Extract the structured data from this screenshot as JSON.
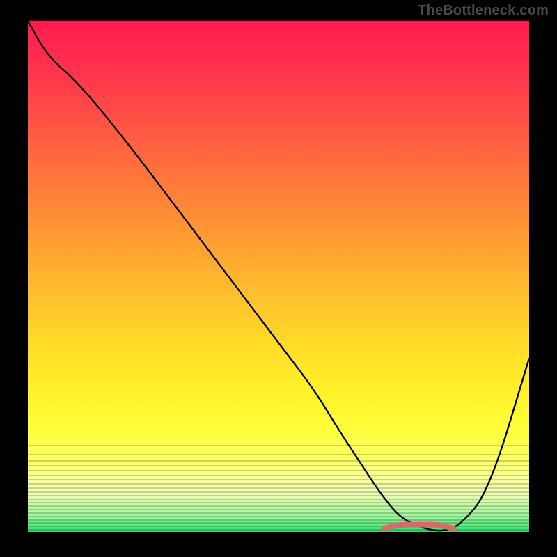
{
  "watermark": "TheBottleneck.com",
  "colors": {
    "frame": "#000000",
    "watermark_text": "#4a4a4a",
    "curve": "#000000",
    "accent": "#d96a6a",
    "gradient_top": "#ff1a52",
    "gradient_bottom": "#2be06a"
  },
  "chart_data": {
    "type": "line",
    "title": "",
    "xlabel": "",
    "ylabel": "",
    "xlim": [
      0,
      100
    ],
    "ylim": [
      0,
      100
    ],
    "x": [
      0,
      4,
      10,
      20,
      30,
      40,
      50,
      57,
      62,
      66,
      70,
      74,
      78,
      82,
      86,
      92,
      100
    ],
    "values": [
      100,
      93,
      88,
      76,
      63,
      50,
      37,
      28,
      20,
      14,
      8,
      3,
      1,
      0,
      1,
      8,
      34
    ],
    "accent_region": {
      "x_start": 71,
      "x_end": 85,
      "y": 1
    },
    "description": "V-shaped bottleneck curve over a smooth red→yellow→green vertical gradient. Lower y is better (green). Curve reaches minimum (~0) around x≈78–82, rises steeply on both sides; small salmon-colored thick segment marks the flat valley."
  },
  "bands": {
    "count": 22,
    "start_y_frac": 0.83,
    "end_y_frac": 1.0
  }
}
